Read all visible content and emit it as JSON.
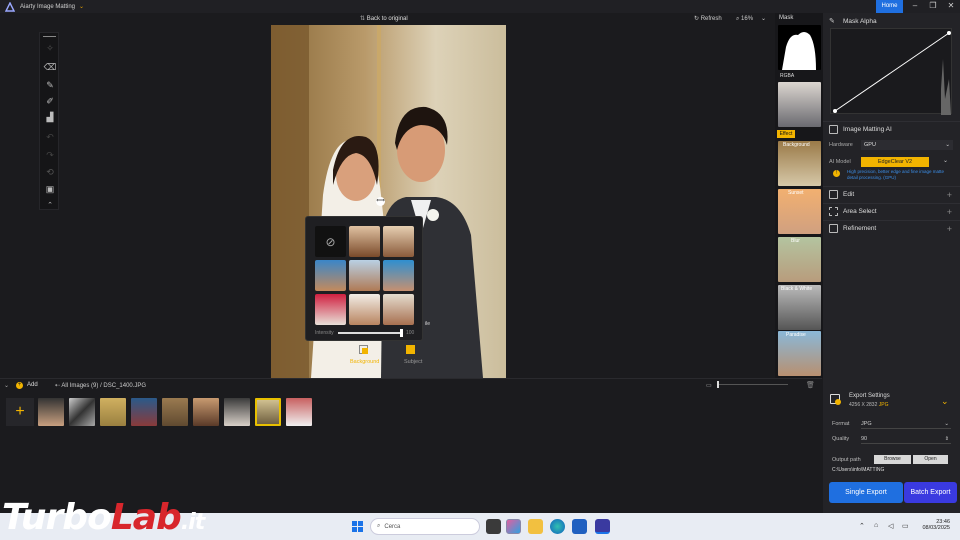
{
  "app": {
    "title": "Aiarty Image Matting",
    "home_label": "Home"
  },
  "topbar": {
    "back_label": "Back to original",
    "refresh_label": "Refresh",
    "zoom_value": "16%"
  },
  "mask_column": {
    "header": "Mask",
    "rgba_label": "RGBA",
    "effect_label": "Effect",
    "labels": [
      "Background",
      "Sunset",
      "Blur",
      "Black & White",
      "Paradise"
    ]
  },
  "right_panel": {
    "mask_alpha_label": "Mask Alpha",
    "image_matting_label": "Image Matting AI",
    "hardware_label": "Hardware",
    "hardware_value": "GPU",
    "ai_model_label": "AI Model",
    "ai_model_value": "EdgeClear V2",
    "ai_model_hint": "High precision, better edge and fine image matte detail processing. (GPU)",
    "sections": [
      "Edit",
      "Area Select",
      "Refinement"
    ]
  },
  "popup": {
    "intensity_label": "Intensity",
    "intensity_value": "100",
    "background_label": "Background",
    "subject_label": "Subject",
    "side_label": "ile"
  },
  "bottom": {
    "add_label": "Add",
    "breadcrumb_all": "All Images (9)",
    "breadcrumb_sep": "/",
    "breadcrumb_file": "DSC_1400.JPG"
  },
  "export": {
    "title": "Export Settings",
    "dims": "4256 X 2832",
    "ext": "JPG",
    "format_label": "Format",
    "format_value": "JPG",
    "quality_label": "Quality",
    "quality_value": "90",
    "output_label": "Output path",
    "browse_label": "Browse",
    "open_label": "Open",
    "path_value": "C:\\Users\\info\\MATTING",
    "single_label": "Single Export",
    "batch_label": "Batch Export"
  },
  "taskbar": {
    "search_placeholder": "Cerca",
    "time": "23:46",
    "date": "08/03/2025"
  },
  "watermark": {
    "part1": "Turbo",
    "part2": "Lab",
    "part3": ".it"
  },
  "colors": {
    "accent": "#1f6fe0",
    "highlight": "#f2b400",
    "panel": "#232327"
  }
}
